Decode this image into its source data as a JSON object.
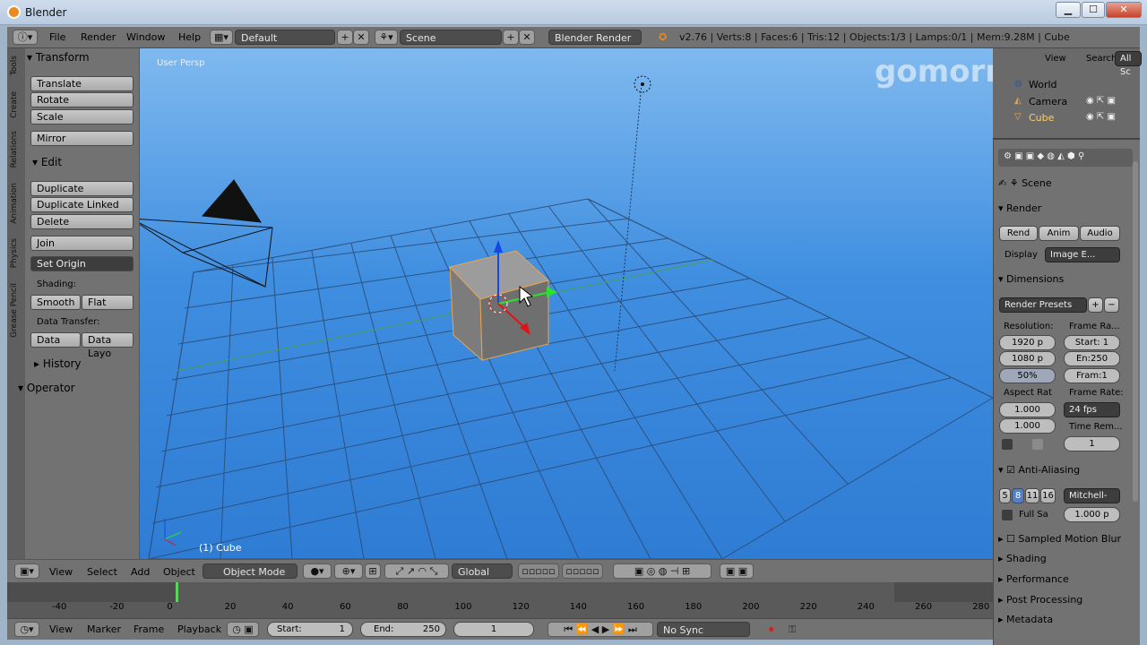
{
  "window": {
    "title": "Blender",
    "min": "▁",
    "max": "☐",
    "close": "✕"
  },
  "menubar": {
    "menus": [
      "File",
      "Render",
      "Window",
      "Help"
    ],
    "layout": "Default",
    "scene": "Scene",
    "engine": "Blender Render",
    "stats": "v2.76 | Verts:8 | Faces:6 | Tris:12 | Objects:1/3 | Lamps:0/1 | Mem:9.28M | Cube"
  },
  "toolshelf": {
    "tabs": [
      "Tools",
      "Create",
      "Relations",
      "Animation",
      "Physics",
      "Grease Pencil"
    ],
    "transform": {
      "header": "Transform",
      "buttons": [
        "Translate",
        "Rotate",
        "Scale"
      ],
      "mirror": "Mirror"
    },
    "edit": {
      "header": "Edit",
      "buttons": [
        "Duplicate",
        "Duplicate Linked",
        "Delete"
      ],
      "join": "Join",
      "set_origin": "Set Origin",
      "shading_label": "Shading:",
      "smooth": "Smooth",
      "flat": "Flat",
      "data_transfer_label": "Data Transfer:",
      "data": "Data",
      "data_layo": "Data Layo"
    },
    "history": "History",
    "operator": "Operator"
  },
  "viewport": {
    "label": "User Persp",
    "object_label": "(1) Cube",
    "watermark": "gomorr.tv"
  },
  "outliner": {
    "view": "View",
    "search": "Search",
    "all_scenes": "All Sc",
    "items": [
      "World",
      "Camera",
      "Cube"
    ]
  },
  "properties": {
    "scene": "Scene",
    "render": {
      "header": "Render",
      "rend": "Rend",
      "anim": "Anim",
      "audio": "Audio",
      "display_label": "Display",
      "display_value": "Image E..."
    },
    "dimensions": {
      "header": "Dimensions",
      "presets": "Render Presets",
      "resolution_label": "Resolution:",
      "res_x": "1920 p",
      "res_y": "1080 p",
      "res_pct": "50%",
      "frame_range_label": "Frame Ra...",
      "start": "Start: 1",
      "end": "En:250",
      "frame": "Fram:1",
      "aspect_label": "Aspect Rat",
      "aspect_x": "1.000",
      "aspect_y": "1.000",
      "frame_rate_label": "Frame Rate:",
      "fps": "24 fps",
      "time_remap_label": "Time Rem...",
      "time_remap": "1"
    },
    "aa": {
      "header": "Anti-Aliasing",
      "samples": [
        "5",
        "8",
        "11",
        "16"
      ],
      "filter": "Mitchell-",
      "full_sample": "Full Sa",
      "size": "1.000 p"
    },
    "collapsed": [
      "Sampled Motion Blur",
      "Shading",
      "Performance",
      "Post Processing",
      "Metadata"
    ]
  },
  "header3d": {
    "menus": [
      "View",
      "Select",
      "Add",
      "Object"
    ],
    "mode": "Object Mode",
    "orientation": "Global"
  },
  "timeline": {
    "ticks": [
      "-40",
      "-20",
      "0",
      "20",
      "40",
      "60",
      "80",
      "100",
      "120",
      "140",
      "160",
      "180",
      "200",
      "220",
      "240",
      "260",
      "280"
    ],
    "current_frame_pos": 0
  },
  "timeline_header": {
    "menus": [
      "View",
      "Marker",
      "Frame",
      "Playback"
    ],
    "start_label": "Start:",
    "start": "1",
    "end_label": "End:",
    "end": "250",
    "current": "1",
    "sync": "No Sync"
  }
}
